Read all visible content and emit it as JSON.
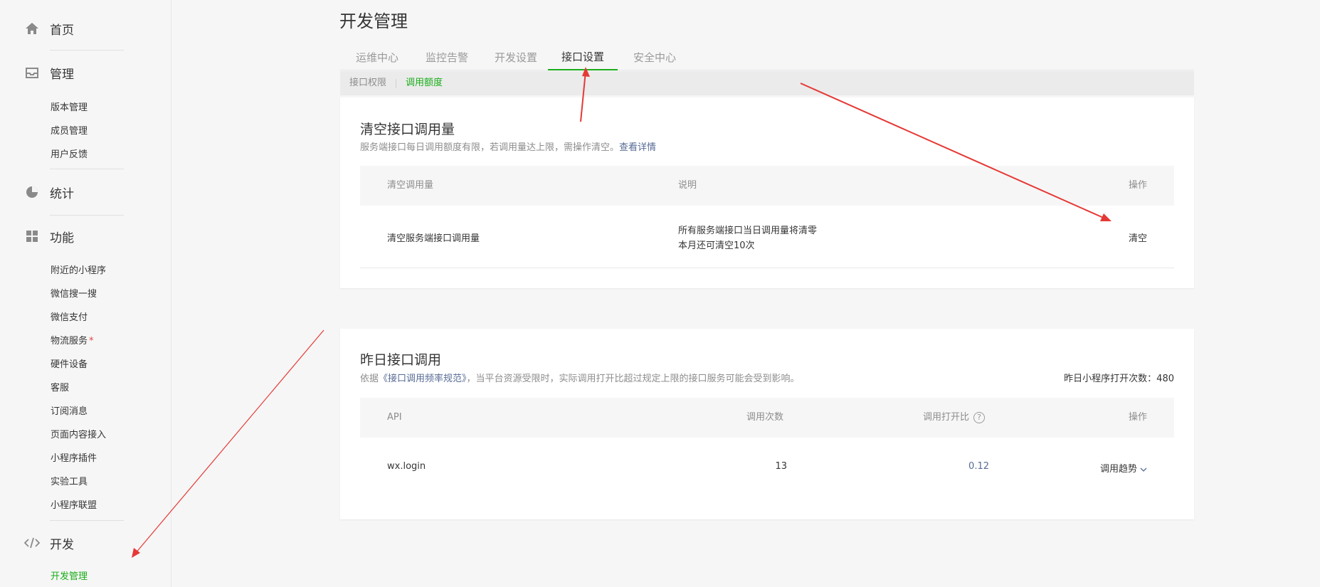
{
  "sidebar": {
    "home": "首页",
    "manage": {
      "label": "管理",
      "items": [
        "版本管理",
        "成员管理",
        "用户反馈"
      ]
    },
    "stats": "统计",
    "features": {
      "label": "功能",
      "items": [
        "附近的小程序",
        "微信搜一搜",
        "微信支付",
        "物流服务",
        "硬件设备",
        "客服",
        "订阅消息",
        "页面内容接入",
        "小程序插件",
        "实验工具",
        "小程序联盟"
      ],
      "logistics_badge": "*"
    },
    "dev": {
      "label": "开发",
      "items": [
        "开发管理"
      ]
    }
  },
  "page": {
    "title": "开发管理"
  },
  "tabs": [
    "运维中心",
    "监控告警",
    "开发设置",
    "接口设置",
    "安全中心"
  ],
  "active_tab": "接口设置",
  "subtabs": [
    "接口权限",
    "调用额度"
  ],
  "active_subtab": "调用额度",
  "clear_card": {
    "title": "清空接口调用量",
    "desc": "服务端接口每日调用额度有限，若调用量达上限，需操作清空。",
    "desc_link": "查看详情",
    "headers": {
      "name": "清空调用量",
      "desc": "说明",
      "op": "操作"
    },
    "row": {
      "name": "清空服务端接口调用量",
      "desc_line1": "所有服务端接口当日调用量将清零",
      "desc_line2": "本月还可清空10次",
      "action": "清空"
    }
  },
  "yesterday_card": {
    "title": "昨日接口调用",
    "desc_prefix": "依据",
    "desc_link": "《接口调用频率规范》",
    "desc_suffix": "，当平台资源受限时，实际调用打开比超过规定上限的接口服务可能会受到影响。",
    "open_count": "昨日小程序打开次数：480",
    "headers": {
      "api": "API",
      "calls": "调用次数",
      "ratio": "调用打开比",
      "op": "操作"
    },
    "help_icon_glyph": "?",
    "rows": [
      {
        "api": "wx.login",
        "calls": "13",
        "ratio": "0.12",
        "action": "调用趋势"
      }
    ]
  },
  "colors": {
    "accent": "#1aad19",
    "link": "#576b95",
    "annotation": "#e53935"
  }
}
